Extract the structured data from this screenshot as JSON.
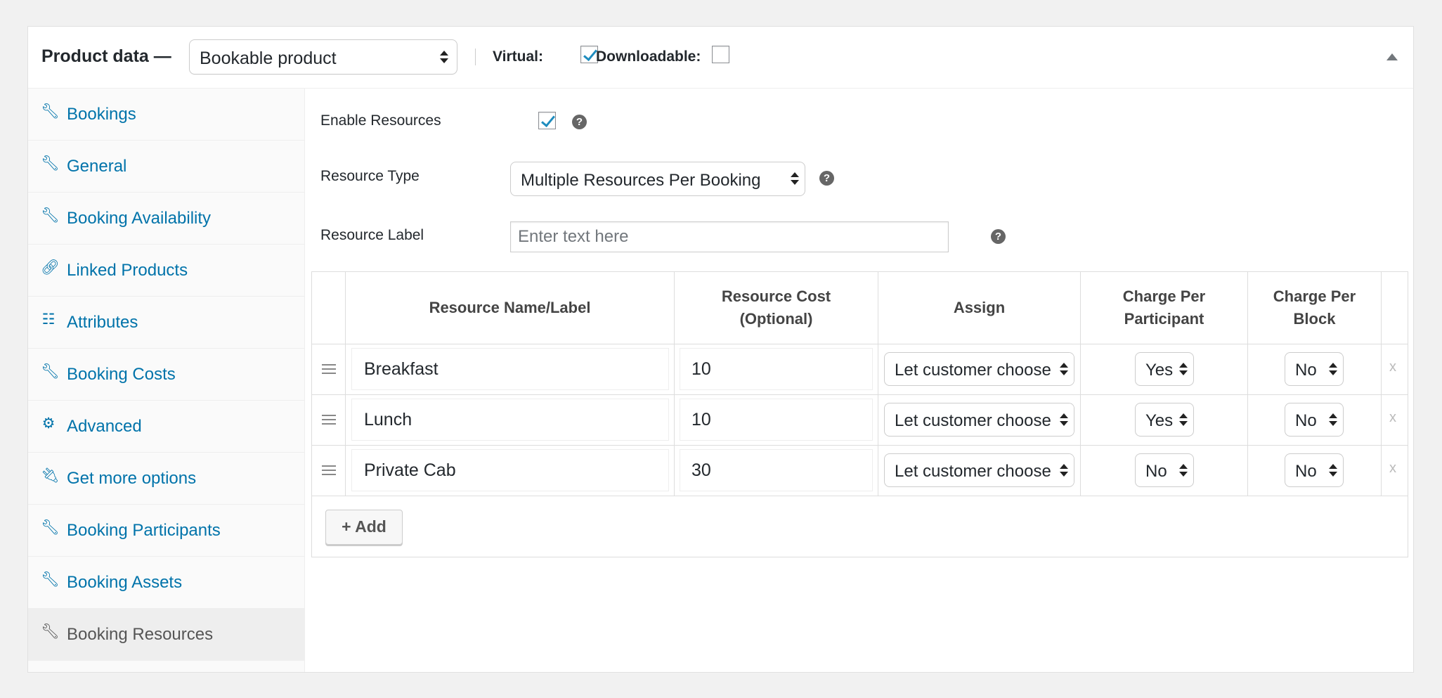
{
  "header": {
    "title": "Product data —",
    "product_type": "Bookable product",
    "virtual_label": "Virtual:",
    "virtual_checked": true,
    "downloadable_label": "Downloadable:",
    "downloadable_checked": false
  },
  "sidebar": {
    "items": [
      {
        "label": "Bookings",
        "icon": "wrench-icon"
      },
      {
        "label": "General",
        "icon": "wrench-icon"
      },
      {
        "label": "Booking Availability",
        "icon": "wrench-icon"
      },
      {
        "label": "Linked Products",
        "icon": "link-icon"
      },
      {
        "label": "Attributes",
        "icon": "list-icon"
      },
      {
        "label": "Booking Costs",
        "icon": "wrench-icon"
      },
      {
        "label": "Advanced",
        "icon": "gear-icon"
      },
      {
        "label": "Get more options",
        "icon": "plugin-icon"
      },
      {
        "label": "Booking Participants",
        "icon": "wrench-icon"
      },
      {
        "label": "Booking Assets",
        "icon": "wrench-icon"
      },
      {
        "label": "Booking Resources",
        "icon": "wrench-icon",
        "active": true
      }
    ]
  },
  "form": {
    "enable_resources_label": "Enable Resources",
    "enable_resources_checked": true,
    "resource_type_label": "Resource Type",
    "resource_type_value": "Multiple Resources Per Booking",
    "resource_label_label": "Resource Label",
    "resource_label_placeholder": "Enter text here",
    "help_glyph": "?"
  },
  "table": {
    "headers": {
      "name": "Resource Name/Label",
      "cost_line1": "Resource Cost",
      "cost_line2": "(Optional)",
      "assign": "Assign",
      "cpp_line1": "Charge Per",
      "cpp_line2": "Participant",
      "cpb_line1": "Charge Per",
      "cpb_line2": "Block"
    },
    "rows": [
      {
        "name": "Breakfast",
        "cost": "10",
        "assign": "Let customer choose",
        "per_participant": "Yes",
        "per_block": "No"
      },
      {
        "name": "Lunch",
        "cost": "10",
        "assign": "Let customer choose",
        "per_participant": "Yes",
        "per_block": "No"
      },
      {
        "name": "Private Cab",
        "cost": "30",
        "assign": "Let customer choose",
        "per_participant": "No",
        "per_block": "No"
      }
    ],
    "remove_glyph": "x",
    "add_label": "+ Add"
  },
  "colors": {
    "link": "#0073aa",
    "checkmark": "#1e8cbe"
  }
}
